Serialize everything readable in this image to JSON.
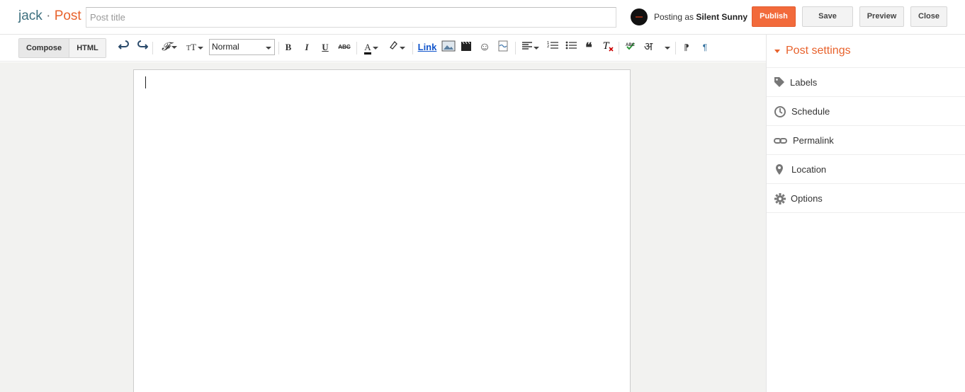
{
  "header": {
    "blog_name": "jack",
    "separator": "·",
    "page_kind": "Post",
    "title_placeholder": "Post title",
    "posting_as_prefix": "Posting as",
    "user_name": "Silent Sunny",
    "buttons": {
      "publish": "Publish",
      "save": "Save",
      "preview": "Preview",
      "close": "Close"
    }
  },
  "toolbar": {
    "modes": {
      "compose": "Compose",
      "html": "HTML"
    },
    "format_value": "Normal",
    "link_label": "Link",
    "bold": "B",
    "italic": "I",
    "underline": "U",
    "strike": "ABC",
    "text_color": "A",
    "hindi": "अ",
    "spell": "ABC"
  },
  "sidebar": {
    "title": "Post settings",
    "items": [
      {
        "label": "Labels",
        "icon": "tag-icon"
      },
      {
        "label": "Schedule",
        "icon": "clock-icon"
      },
      {
        "label": "Permalink",
        "icon": "link-icon"
      },
      {
        "label": "Location",
        "icon": "pin-icon"
      },
      {
        "label": "Options",
        "icon": "gear-icon"
      }
    ]
  },
  "colors": {
    "accent": "#e8622c",
    "publish": "#f26a3b",
    "blog_name": "#3d6f7e"
  }
}
